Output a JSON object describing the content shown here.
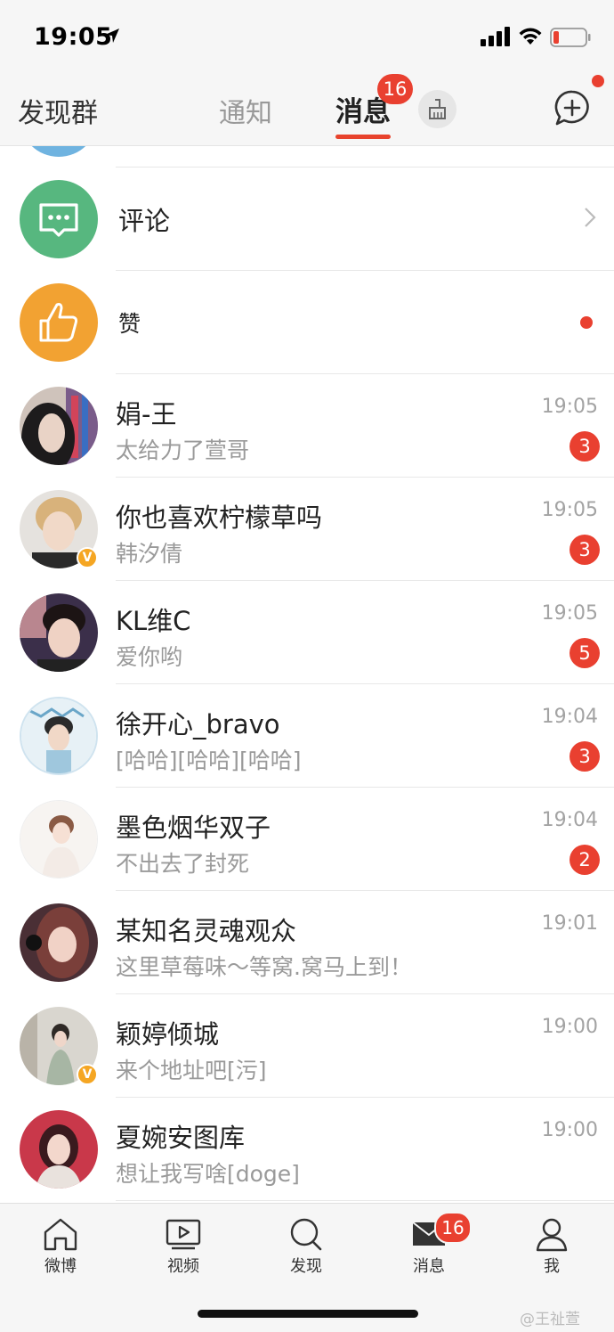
{
  "status": {
    "time": "19:05"
  },
  "header": {
    "left": "发现群",
    "tab_notify": "通知",
    "tab_msg": "消息",
    "msg_badge": "16"
  },
  "system_rows": [
    {
      "title": "评论",
      "icon": "comment-icon",
      "color": "#57b77f"
    },
    {
      "title": "赞",
      "icon": "thumbs-up-icon",
      "color": "#f2a232"
    }
  ],
  "messages": [
    {
      "name": "娟-王",
      "preview": "太给力了萱哥",
      "time": "19:05",
      "count": "3",
      "verified": false
    },
    {
      "name": "你也喜欢柠檬草吗",
      "preview": "韩汐倩",
      "time": "19:05",
      "count": "3",
      "verified": true
    },
    {
      "name": "KL维C",
      "preview": "爱你哟",
      "time": "19:05",
      "count": "5",
      "verified": false
    },
    {
      "name": "徐开心_bravo",
      "preview": "[哈哈][哈哈][哈哈]",
      "time": "19:04",
      "count": "3",
      "verified": false
    },
    {
      "name": "墨色烟华双子",
      "preview": "不出去了封死",
      "time": "19:04",
      "count": "2",
      "verified": false
    },
    {
      "name": "某知名灵魂观众",
      "preview": "这里草莓味～等窝.窝马上到！",
      "time": "19:01",
      "count": "",
      "verified": false
    },
    {
      "name": "颖婷倾城",
      "preview": "来个地址吧[污]",
      "time": "19:00",
      "count": "",
      "verified": true
    },
    {
      "name": "夏婉安图库",
      "preview": "想让我写啥[doge]",
      "time": "19:00",
      "count": "",
      "verified": false
    }
  ],
  "tabbar": {
    "items": [
      "微博",
      "视频",
      "发现",
      "消息",
      "我"
    ],
    "msg_badge": "16"
  },
  "watermark": "@王祉萱"
}
